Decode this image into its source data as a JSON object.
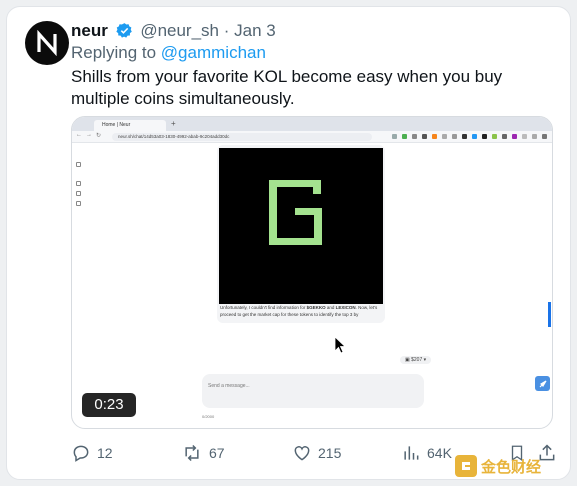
{
  "tweet": {
    "display_name": "neur",
    "handle": "@neur_sh",
    "separator": "·",
    "date": "Jan 3",
    "replying_prefix": "Replying to",
    "replying_to": "@gammichan",
    "text": "Shills from your favorite KOL become easy when you buy multiple coins simultaneously."
  },
  "video": {
    "duration": "0:23",
    "browser": {
      "tab_title": "Home | Neur",
      "url": "neur.sh/chat/14d53a03-1830-4992-abab-9c204add30dc"
    },
    "chat": {
      "caption_pre": "Unfortunately, I couldn't find information for ",
      "caption_token1": "$GEKKO",
      "caption_mid": " and ",
      "caption_token2": "LEXICON",
      "caption_post": ". Now, let's proceed to get the market cap for these tokens to identify the top 3 by",
      "sol_pill": "$207",
      "input_placeholder": "Send a message...",
      "credits": "0/2000"
    }
  },
  "actions": {
    "replies": "12",
    "reposts": "67",
    "likes": "215",
    "views": "64K"
  },
  "watermark": {
    "text": "金色财经"
  },
  "colors": {
    "link": "#1d9bf0",
    "text": "#0f1419",
    "muted": "#536471",
    "g_logo": "#a4e28f",
    "watermark": "#e8b43a"
  }
}
